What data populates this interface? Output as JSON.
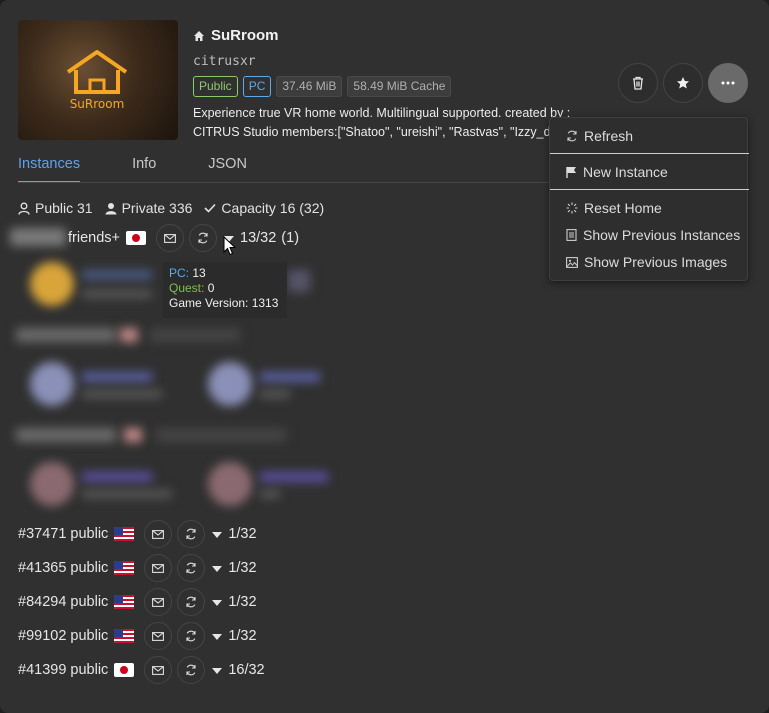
{
  "world": {
    "title": "SuRroom",
    "author": "citrusxr",
    "logo_text": "SuRroom",
    "tags": [
      "Public",
      "PC",
      "37.46 MiB",
      "58.49 MiB Cache"
    ],
    "description_line1": "Experience true VR home world. Multilingual supported. created by :",
    "description_line2": "CITRUS Studio members:[\"Shatoo\", \"ureishi\", \"Rastvas\", \"Izzy_da"
  },
  "tabs": [
    "Instances",
    "Info",
    "JSON"
  ],
  "stats": {
    "public": "Public 31",
    "private": "Private 336",
    "capacity": "Capacity 16 (32)"
  },
  "friends_instance": {
    "name": "friends+",
    "count": "13/32",
    "friends_count": "(1)"
  },
  "tooltip": {
    "pc_label": "PC:",
    "pc_value": " 13",
    "quest_label": "Quest:",
    "quest_value": " 0",
    "version": "Game Version: 1313"
  },
  "instances": [
    {
      "name": "#37471 public",
      "count": "1/32",
      "region": "us"
    },
    {
      "name": "#41365 public",
      "count": "1/32",
      "region": "us"
    },
    {
      "name": "#84294 public",
      "count": "1/32",
      "region": "us"
    },
    {
      "name": "#99102 public",
      "count": "1/32",
      "region": "us"
    },
    {
      "name": "#41399 public",
      "count": "16/32",
      "region": "jp"
    }
  ],
  "menu": {
    "refresh": "Refresh",
    "new_instance": "New Instance",
    "reset_home": "Reset Home",
    "show_previous_instances": "Show Previous Instances",
    "show_previous_images": "Show Previous Images"
  },
  "colors": {
    "accent": "#5aa3ee",
    "pc_blue": "#5ea9e6",
    "quest_green": "#7cc24b",
    "logo_orange": "#f5a623"
  },
  "icons": [
    "home-icon",
    "trash-icon",
    "star-icon",
    "more-icon",
    "invite-icon",
    "refresh-icon",
    "caret-down-icon",
    "user-icon",
    "check-icon",
    "flag-icon",
    "sparkle-icon",
    "document-icon",
    "image-icon"
  ]
}
